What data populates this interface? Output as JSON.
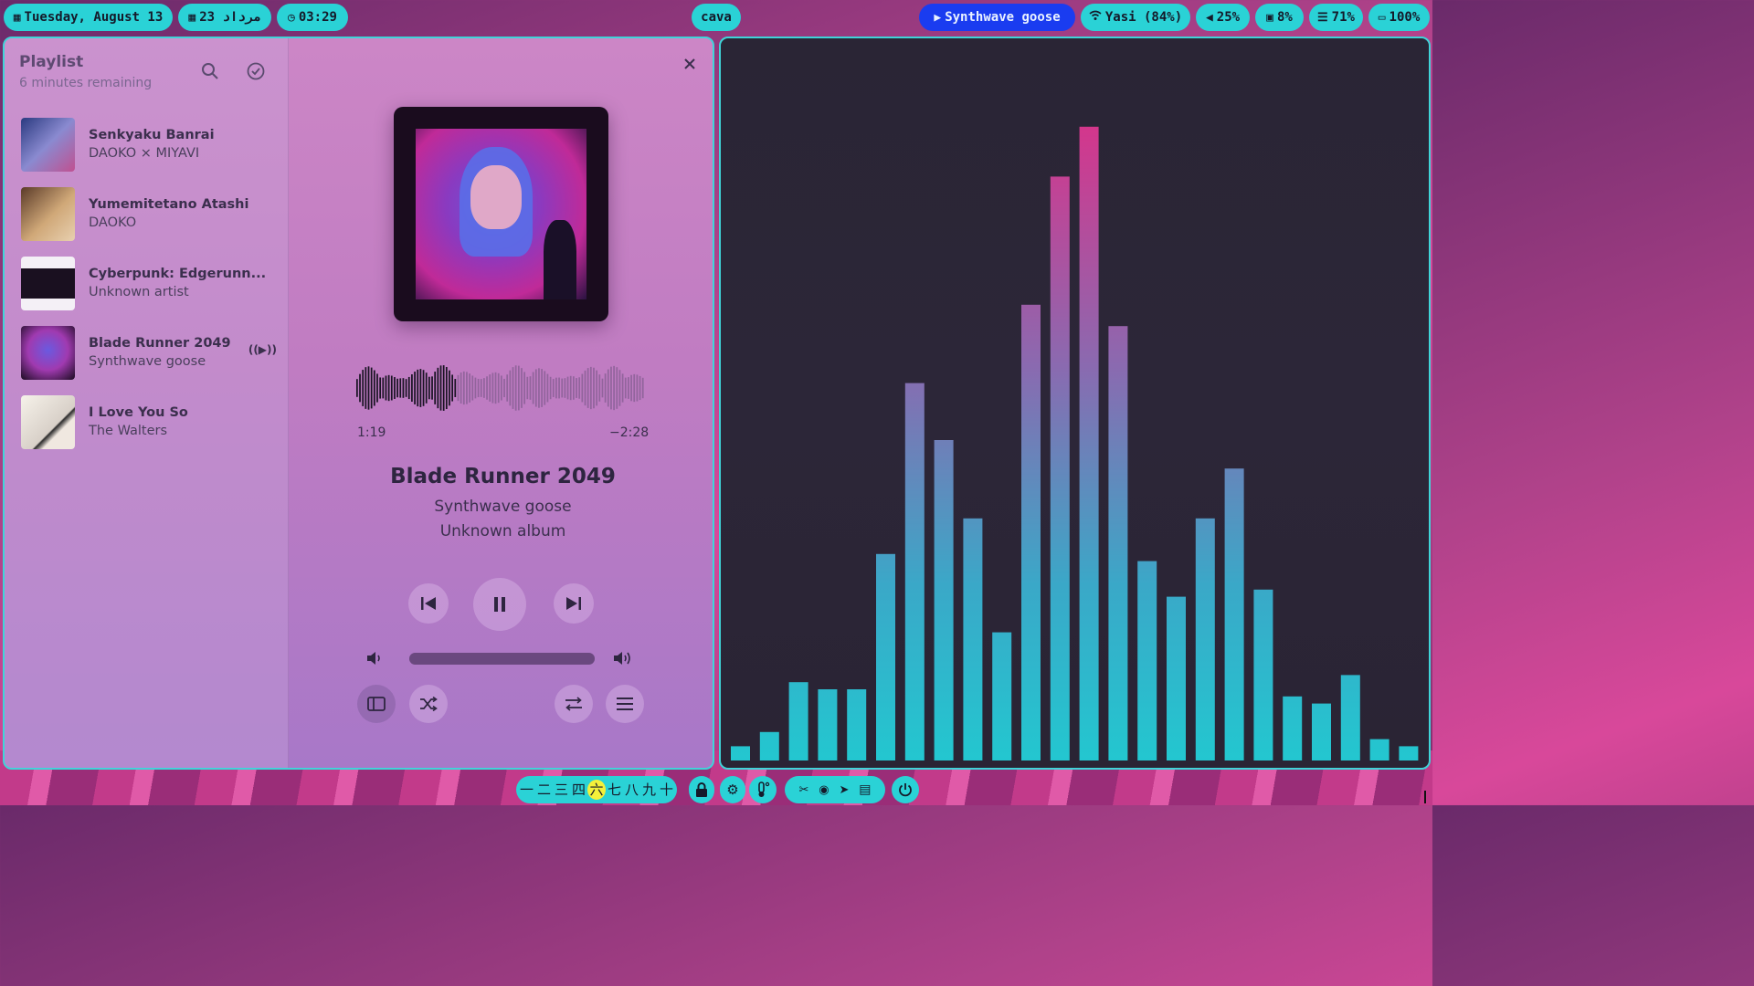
{
  "colors": {
    "pill_bg": "#2ad2d6",
    "media_pill_bg": "#1a3cf0",
    "border_accent": "#3fd4d8",
    "viz_bar_top": "#d8338a",
    "viz_bar_bottom": "#22c8d0"
  },
  "topbar": {
    "date": "Tuesday, August 13",
    "persian_date": "23 مرداد",
    "clock": "03:29",
    "workspace_app": "cava",
    "media": "Synthwave goose",
    "wifi": "Yasi (84%)",
    "volume": "25%",
    "cpu": "8%",
    "memory": "71%",
    "battery": "100%",
    "icons": [
      "calendar-icon",
      "calendar-icon",
      "clock-icon",
      "play-icon",
      "wifi-icon",
      "speaker-icon",
      "cpu-icon",
      "memory-icon",
      "battery-icon"
    ]
  },
  "playlist": {
    "title": "Playlist",
    "subtitle": "6 minutes remaining",
    "tracks": [
      {
        "title": "Senkyaku Banrai",
        "artist": "DAOKO × MIYAVI",
        "thumb_color": "#4a5aa0"
      },
      {
        "title": "Yumemitetano Atashi",
        "artist": "DAOKO",
        "thumb_color": "#a07a5a"
      },
      {
        "title": "Cyberpunk: Edgerunn...",
        "artist": "Unknown artist",
        "thumb_color": "#d8c8e0"
      },
      {
        "title": "Blade Runner 2049",
        "artist": "Synthwave goose",
        "thumb_color": "#6a3a9a",
        "playing": true
      },
      {
        "title": "I Love You So",
        "artist": "The Walters",
        "thumb_color": "#e8e0d8"
      }
    ]
  },
  "now_playing": {
    "title": "Blade Runner 2049",
    "artist": "Synthwave goose",
    "album": "Unknown album",
    "elapsed": "1:19",
    "remaining": "−2:28",
    "progress": 0.35,
    "volume_level": 1.0
  },
  "controls": {
    "previous": "previous-icon",
    "play_pause": "pause-icon",
    "next": "next-icon",
    "volume_down": "volume-low-icon",
    "volume_up": "volume-high-icon",
    "sidebar_toggle": "sidebar-icon",
    "shuffle": "shuffle-icon",
    "repeat": "repeat-icon",
    "menu": "menu-icon"
  },
  "chart_data": {
    "type": "bar",
    "values": [
      0.02,
      0.04,
      0.11,
      0.1,
      0.1,
      0.29,
      0.53,
      0.45,
      0.34,
      0.18,
      0.64,
      0.82,
      0.89,
      0.61,
      0.28,
      0.23,
      0.34,
      0.41,
      0.24,
      0.09,
      0.08,
      0.12,
      0.03,
      0.02
    ],
    "ylim": [
      0,
      1
    ]
  },
  "bottombar": {
    "workspaces": [
      "一",
      "二",
      "三",
      "四",
      "六",
      "七",
      "八",
      "九",
      "十"
    ],
    "active_workspace": "六",
    "tray_icons": [
      "lock-icon",
      "settings-icon",
      "thermometer-icon",
      "scissors-icon",
      "record-icon",
      "telegram-icon",
      "screenshot-icon",
      "power-icon"
    ]
  }
}
